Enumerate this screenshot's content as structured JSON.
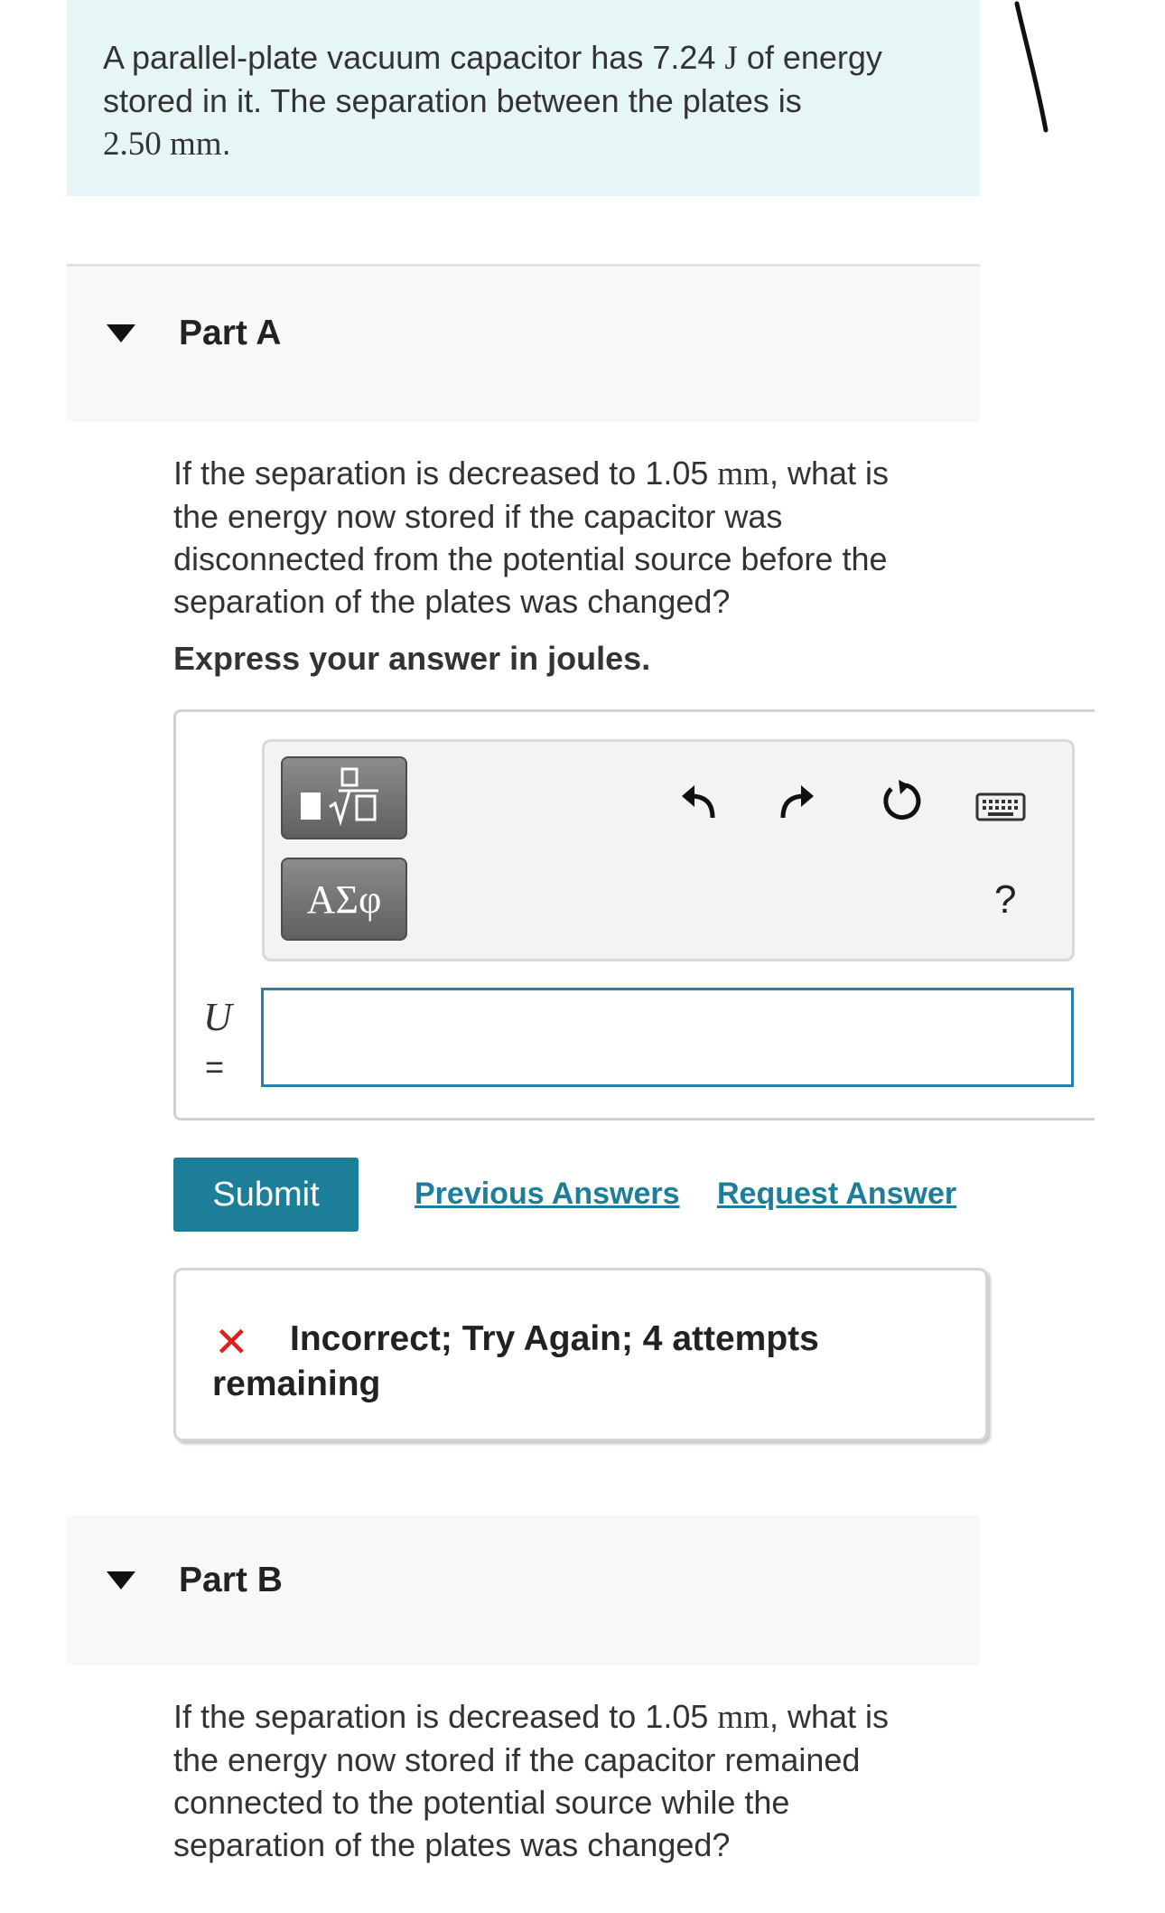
{
  "intro": {
    "line1_a": "A parallel-plate vacuum capacitor has 7.24 ",
    "line1_unit": "J",
    "line1_b": " of energy",
    "line2": "stored in it. The separation between the plates is",
    "line3_value": "2.50 mm",
    "line3_end": "."
  },
  "part_a": {
    "title": "Part A",
    "q_line1_a": "If the separation is decreased to 1.05 ",
    "q_line1_unit": "mm",
    "q_line1_b": ", what is",
    "q_line2": "the energy now stored if the capacitor was",
    "q_line3": "disconnected from the potential source before the",
    "q_line4": "separation of the plates was changed?",
    "instruction": "Express your answer in joules.",
    "toolbar": {
      "template_icon": "fraction-sqrt-template-icon",
      "greek_button": "ΑΣφ",
      "undo_icon": "undo-icon",
      "redo_icon": "redo-icon",
      "reset_icon": "reset-icon",
      "keyboard_icon": "keyboard-icon",
      "help": "?"
    },
    "variable": "U",
    "equals": "=",
    "answer_value": "",
    "submit": "Submit",
    "previous_answers": "Previous Answers",
    "request_answer": "Request Answer",
    "feedback_icon": "✕",
    "feedback_line1": "Incorrect; Try Again; 4 attempts",
    "feedback_line2": "remaining"
  },
  "part_b": {
    "title": "Part B",
    "q_line1_a": "If the separation is decreased to 1.05 ",
    "q_line1_unit": "mm",
    "q_line1_b": ", what is",
    "q_line2": "the energy now stored if the capacitor remained",
    "q_line3": "connected to the potential source while the",
    "q_line4": "separation of the plates was changed?"
  },
  "colors": {
    "intro_bg": "#e6f5f5",
    "accent": "#1d7e99",
    "error": "#e0201a",
    "input_border": "#2a7fa8"
  }
}
